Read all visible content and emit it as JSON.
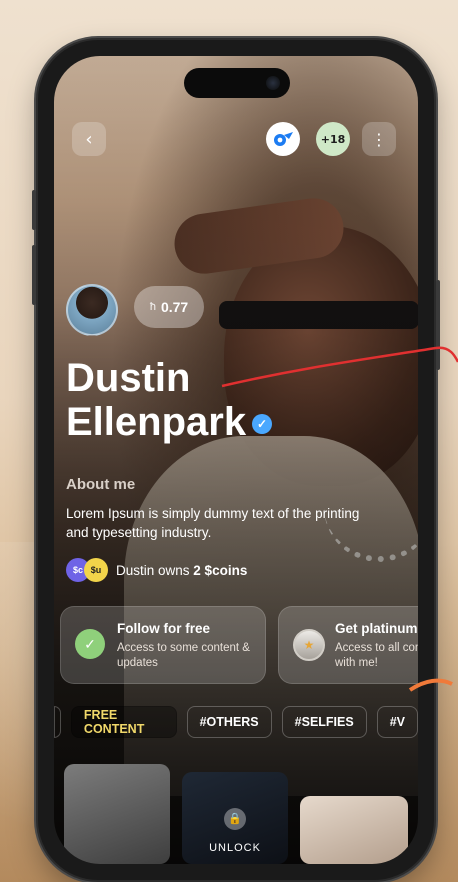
{
  "profile": {
    "first_name": "Dustin",
    "last_name": "Ellenpark",
    "coin_symbol": "ħ",
    "coin_value": "0.77"
  },
  "topbar": {
    "plus_count": "+18"
  },
  "about": {
    "heading": "About me",
    "text": "Lorem Ipsum is simply dummy text of the printing and typesetting industry.",
    "owns_prefix": "Dustin owns ",
    "owns_value": "2 $coins",
    "icon1": "$c",
    "icon2": "$u"
  },
  "cards": [
    {
      "title": "Follow for free",
      "subtitle": "Access to some content & updates",
      "icon": "check-icon"
    },
    {
      "title": "Get platinum",
      "subtitle": "Access to all content and DM with me!",
      "icon": "medal-icon"
    }
  ],
  "tabs": [
    "FREE CONTENT",
    "#OTHERS",
    "#SELFIES",
    "#V"
  ],
  "gallery": {
    "unlock_label": "UNLOCK"
  },
  "colors": {
    "accent_tab": "#f0d86a",
    "verified": "#4aa8ff",
    "annotation": "#e03030"
  }
}
